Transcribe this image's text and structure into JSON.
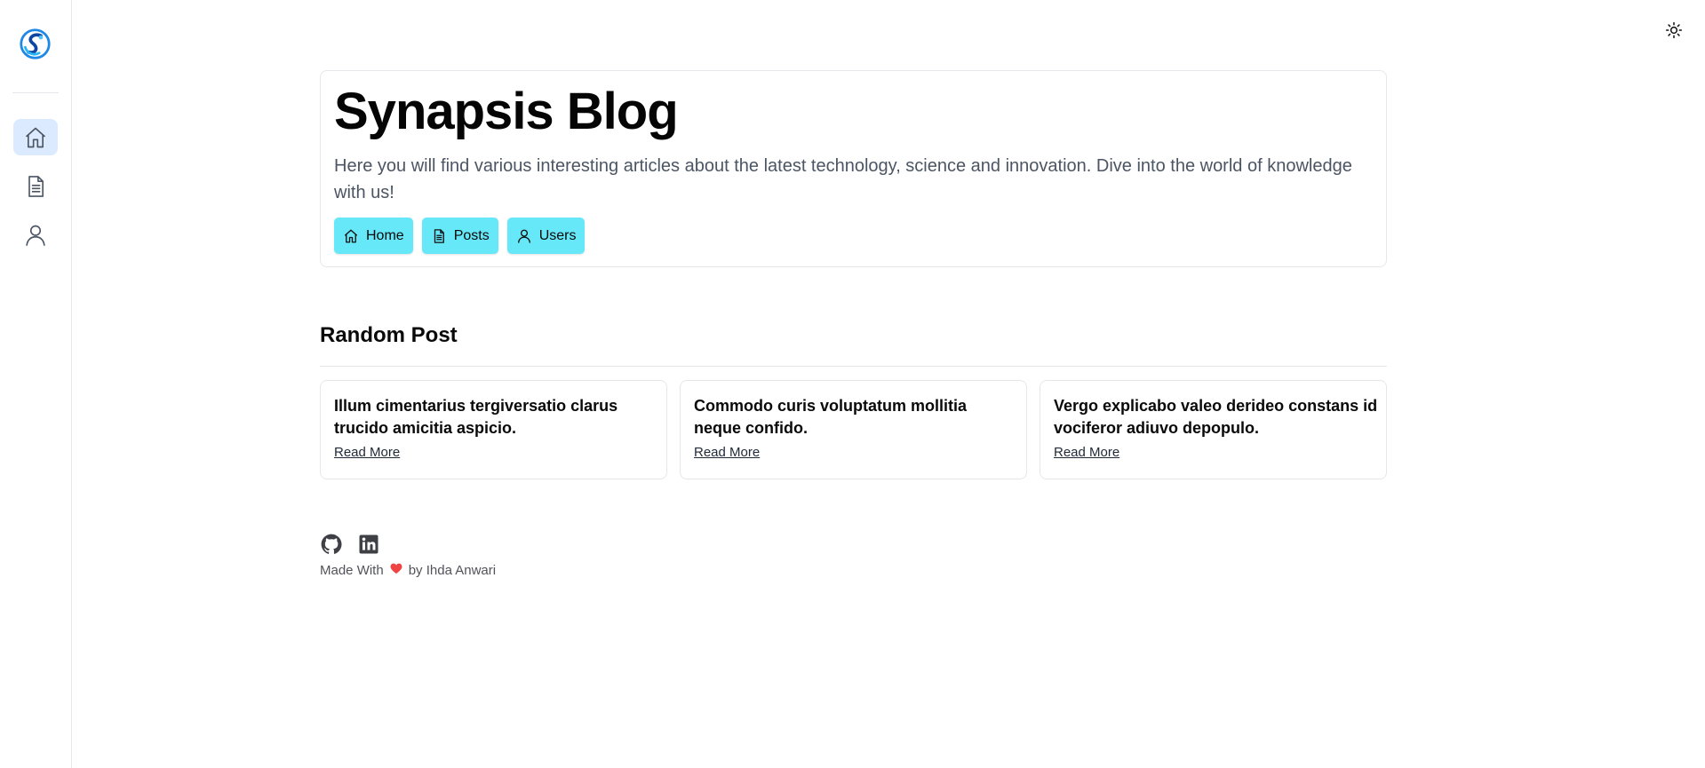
{
  "sidebar": {
    "items": [
      {
        "name": "home",
        "icon": "home-icon",
        "active": true
      },
      {
        "name": "posts",
        "icon": "document-icon",
        "active": false
      },
      {
        "name": "users",
        "icon": "user-icon",
        "active": false
      }
    ]
  },
  "header": {
    "theme_icon": "sun-icon"
  },
  "hero": {
    "title": "Synapsis Blog",
    "description": "Here you will find various interesting articles about the latest technology, science and innovation. Dive into the world of knowledge with us!",
    "buttons": [
      {
        "label": "Home",
        "icon": "home-icon"
      },
      {
        "label": "Posts",
        "icon": "document-icon"
      },
      {
        "label": "Users",
        "icon": "user-icon"
      }
    ]
  },
  "random_post": {
    "heading": "Random Post",
    "posts": [
      {
        "title": "Illum cimentarius tergiversatio clarus trucido amicitia aspicio.",
        "link": "Read More"
      },
      {
        "title": "Commodo curis voluptatum mollitia neque confido.",
        "link": "Read More"
      },
      {
        "title": "Vergo explicabo valeo derideo constans id vociferor adiuvo depopulo.",
        "link": "Read More"
      }
    ]
  },
  "footer": {
    "made_with": "Made With",
    "by": "by Ihda Anwari",
    "icons": [
      "github-icon",
      "linkedin-icon",
      "heart-icon"
    ]
  },
  "colors": {
    "accent_button": "#67e8f9",
    "active_nav_bg": "#dbeafe",
    "heart": "#ef4444"
  }
}
